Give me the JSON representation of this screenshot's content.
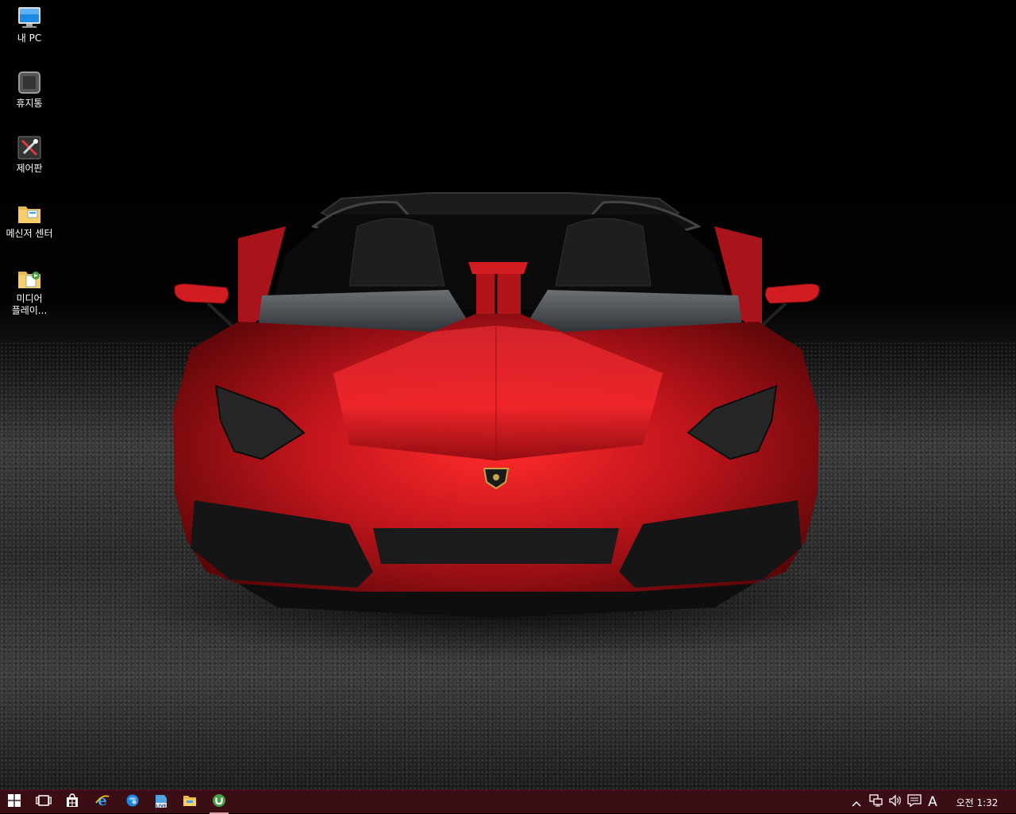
{
  "desktop": {
    "icons": [
      {
        "label": "내 PC",
        "icon": "this-pc-icon"
      },
      {
        "label": "휴지통",
        "icon": "recycle-bin-icon"
      },
      {
        "label": "제어판",
        "icon": "control-panel-icon"
      },
      {
        "label": "메신저 센터",
        "icon": "messenger-center-folder-icon"
      },
      {
        "label": "미디어 플레이...",
        "icon": "media-player-folder-icon"
      }
    ],
    "wallpaper": {
      "subject": "red-sports-car",
      "accent": "#c0151c"
    }
  },
  "taskbar": {
    "color": "#3b0d14",
    "pinned": [
      "windows-start-icon",
      "task-view-icon",
      "store-icon",
      "internet-explorer-icon",
      "browser-icon",
      "windows-live-icon",
      "file-explorer-icon",
      "utorrent-icon"
    ],
    "tray": {
      "ime_indicator": "A",
      "clock": "오전 1:32"
    }
  }
}
